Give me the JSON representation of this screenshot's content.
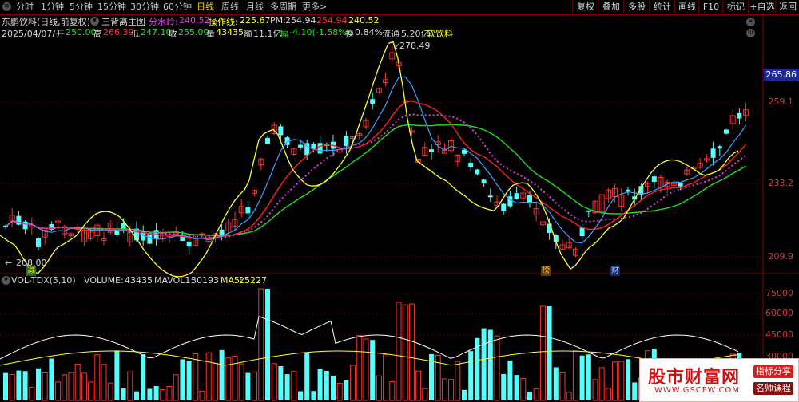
{
  "toolbar": {
    "periods": [
      "分时",
      "1分钟",
      "5分钟",
      "15分钟",
      "30分钟",
      "60分钟",
      "日线",
      "周线",
      "月线",
      "多周期",
      "更多>"
    ],
    "active_period": "日线",
    "buttons": [
      "复权",
      "叠加",
      "多股",
      "统计",
      "画线",
      "F10",
      "标记",
      "+自选",
      "返回"
    ]
  },
  "info": {
    "stock_name": "东鹏饮料(日线,前复权)",
    "indicator": "三背离主图",
    "fenshuiling_label": "分水岭:",
    "fenshuiling_value": "240.52",
    "caozuoxian_label": "操作线:",
    "caozuoxian_value": "225.67",
    "pm_label": "PM:",
    "pm_value": "254.94",
    "pm_value2": "254.94",
    "pm_value3": "240.52",
    "date": "2025/04/07/一",
    "open_label": "开",
    "open": "250.00",
    "high_label": "高",
    "high": "266.39",
    "low_label": "低",
    "low": "247.10",
    "close_label": "收",
    "close": "255.00",
    "vol_label": "量",
    "vol": "43435",
    "amount_label": "额",
    "amount": "11.1亿",
    "change_label": "幅",
    "change": "-4.10(-1.58%)",
    "turnover_label": "换",
    "turnover": "0.84%",
    "float_label": "流通",
    "float_cap": "5.20亿",
    "sector": "软饮料"
  },
  "price_axis": {
    "labels": [
      "259.1",
      "233.2",
      "209.9"
    ],
    "current_tag": "265.86",
    "high_annotation": "278.49",
    "low_annotation": "208.00"
  },
  "markers": {
    "m1": "减",
    "m2": "榜",
    "m3": "财"
  },
  "volume": {
    "indicator": "VOL-TDX(5,10)",
    "volume_label": "VOLUME:",
    "volume_value": "43435",
    "mavol1_label": "MAVOL1:",
    "mavol1_value": "30193",
    "ma5_label": "MA5:",
    "ma5_value": "25227",
    "axis_labels": [
      "75000",
      "60000",
      "45000",
      "30000"
    ]
  },
  "ad": {
    "title": "股市财富网",
    "url": "WWW.GSCFW.COM",
    "tag1": "指标分享",
    "tag2": "名师课程"
  },
  "colors": {
    "up": "#ff3232",
    "down": "#54ffff",
    "ma_red": "#ff2020",
    "ma_green": "#20e020",
    "ma_blue": "#3aa0ff",
    "ma_white": "#ffffff",
    "ma_yellow": "#ffff30",
    "ma_magenta": "#e040e0"
  }
}
